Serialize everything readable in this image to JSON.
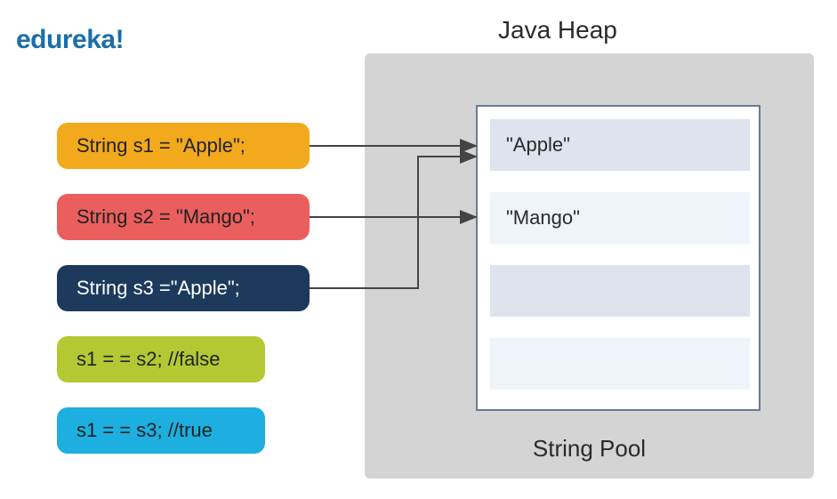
{
  "logo": "edureka!",
  "heap": {
    "title": "Java Heap",
    "pool_label": "String Pool",
    "slots": [
      "\"Apple\"",
      "\"Mango\"",
      "",
      ""
    ]
  },
  "code": {
    "s1": "String s1 = \"Apple\";",
    "s2": "String s2 = \"Mango\";",
    "s3": "String s3 =\"Apple\";",
    "cmp1": "s1 = = s2; //false",
    "cmp2": "s1 = = s3; //true"
  }
}
